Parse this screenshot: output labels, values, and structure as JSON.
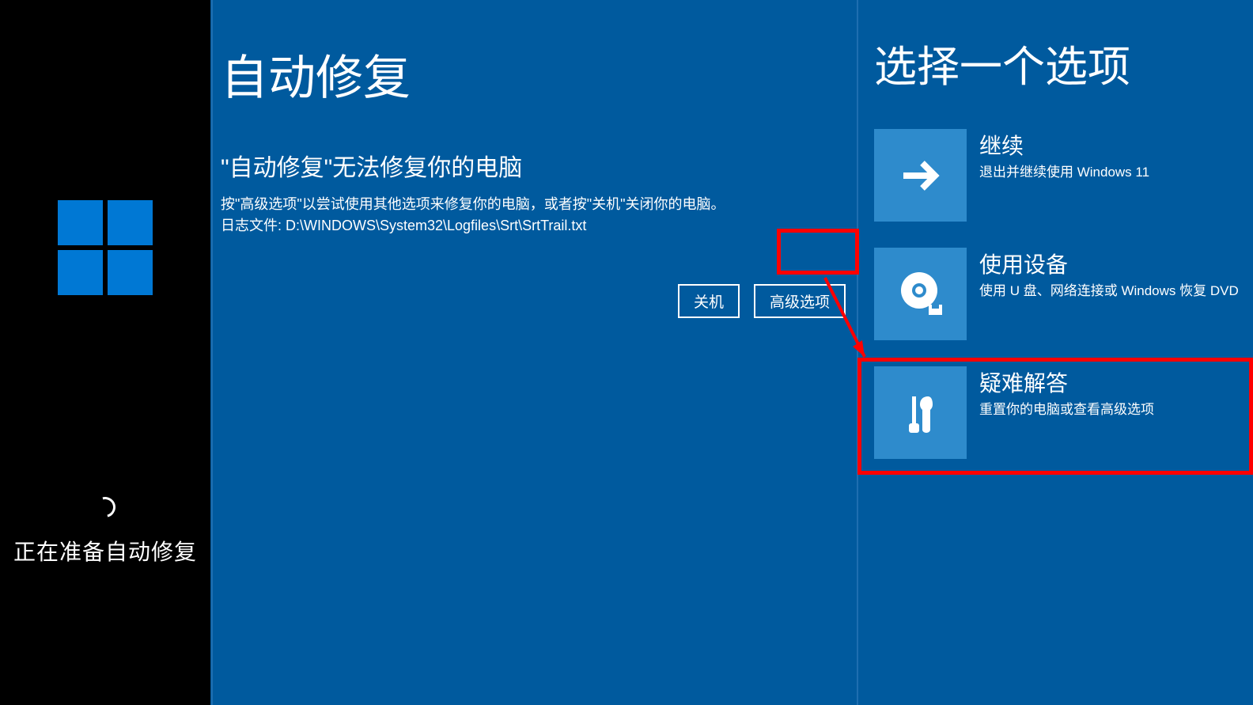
{
  "boot": {
    "status": "正在准备自动修复"
  },
  "repair": {
    "title": "自动修复",
    "subtitle": "\"自动修复\"无法修复你的电脑",
    "hint": "按\"高级选项\"以尝试使用其他选项来修复你的电脑，或者按\"关机\"关闭你的电脑。",
    "log": "日志文件: D:\\WINDOWS\\System32\\Logfiles\\Srt\\SrtTrail.txt",
    "buttons": {
      "shutdown": "关机",
      "advanced": "高级选项"
    }
  },
  "choose": {
    "title": "选择一个选项",
    "options": [
      {
        "title": "继续",
        "desc": "退出并继续使用 Windows 11",
        "icon": "arrow-right"
      },
      {
        "title": "使用设备",
        "desc": "使用 U 盘、网络连接或 Windows 恢复 DVD",
        "icon": "disc"
      },
      {
        "title": "疑难解答",
        "desc": "重置你的电脑或查看高级选项",
        "icon": "tools"
      }
    ]
  }
}
